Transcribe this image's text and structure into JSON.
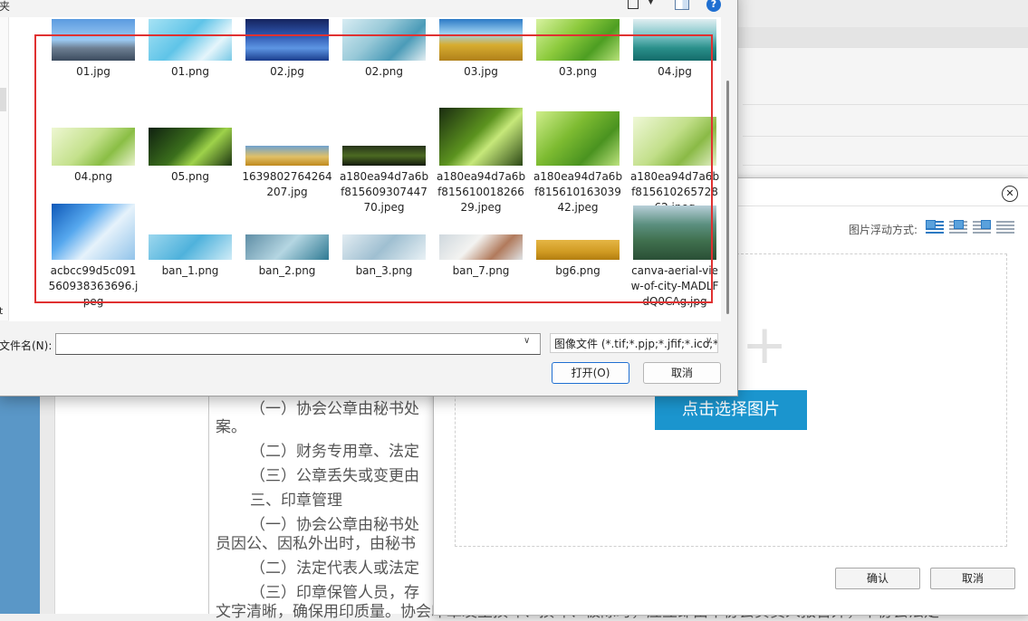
{
  "file_dialog": {
    "title_fragment": "夹",
    "nav_letter": "t",
    "files": [
      {
        "name": "01.jpg",
        "thumb": "factory"
      },
      {
        "name": "01.png",
        "thumb": "lab-hand"
      },
      {
        "name": "02.jpg",
        "thumb": "ocean-ship"
      },
      {
        "name": "02.png",
        "thumb": "lab-flask"
      },
      {
        "name": "03.jpg",
        "thumb": "wheat-field"
      },
      {
        "name": "03.png",
        "thumb": "leaf-green"
      },
      {
        "name": "04.jpg",
        "thumb": "banner-green"
      },
      {
        "name": "04.png",
        "thumb": "plant-sprout"
      },
      {
        "name": "05.png",
        "thumb": "leaf-drop-dark"
      },
      {
        "name": "1639802764264207.jpg",
        "thumb": "wheat-panorama"
      },
      {
        "name": "a180ea94d7a6bf81560930744770.jpeg",
        "thumb": "dark-grass"
      },
      {
        "name": "a180ea94d7a6bf81561001826629.jpeg",
        "thumb": "leaf-drop"
      },
      {
        "name": "a180ea94d7a6bf81561016303942.jpeg",
        "thumb": "leaf-green2"
      },
      {
        "name": "a180ea94d7a6bf81561026572862.jpeg",
        "thumb": "plant-sprout2"
      },
      {
        "name": "acbcc99d5c091560938363696.jpeg",
        "thumb": "test-tubes"
      },
      {
        "name": "ban_1.png",
        "thumb": "banner-lab-blue"
      },
      {
        "name": "ban_2.png",
        "thumb": "banner-lab-teal"
      },
      {
        "name": "ban_3.png",
        "thumb": "banner-lab-light"
      },
      {
        "name": "ban_7.png",
        "thumb": "banner-people"
      },
      {
        "name": "bg6.png",
        "thumb": "banner-wheat"
      },
      {
        "name": "canva-aerial-view-of-city-MADLFdQ0CAg.jpg",
        "thumb": "aerial"
      }
    ],
    "filename_label": "文件名(N):",
    "filename_value": "",
    "filetype_value": "图像文件 (*.tif;*.pjp;*.jfif;*.ico;*",
    "open_label": "打开(O)",
    "cancel_label": "取消"
  },
  "image_dialog": {
    "float_label": "图片浮动方式:",
    "pick_label": "点击选择图片",
    "ok_label": "确认",
    "cancel_label": "取消"
  },
  "document": {
    "lines": [
      {
        "text": "（一）协会公章由秘书处",
        "indent": true
      },
      {
        "text": "案。",
        "indent": false
      },
      {
        "text": "（二）财务专用章、法定",
        "indent": true
      },
      {
        "text": "（三）公章丢失或变更由",
        "indent": true
      },
      {
        "text": "三、印章管理",
        "indent": true
      },
      {
        "text": "（一）协会公章由秘书处",
        "indent": true
      },
      {
        "text": "员因公、因私外出时，由秘书",
        "indent": false
      },
      {
        "text": "（二）法定代表人或法定",
        "indent": true
      },
      {
        "text": "（三）印章保管人员，存",
        "indent": true
      },
      {
        "text": "文字清晰，确保用印质量。协会印章发生损坏、损坏、被除时，应立即由本协会负责人报告外，本协会法定",
        "indent": false
      }
    ]
  }
}
